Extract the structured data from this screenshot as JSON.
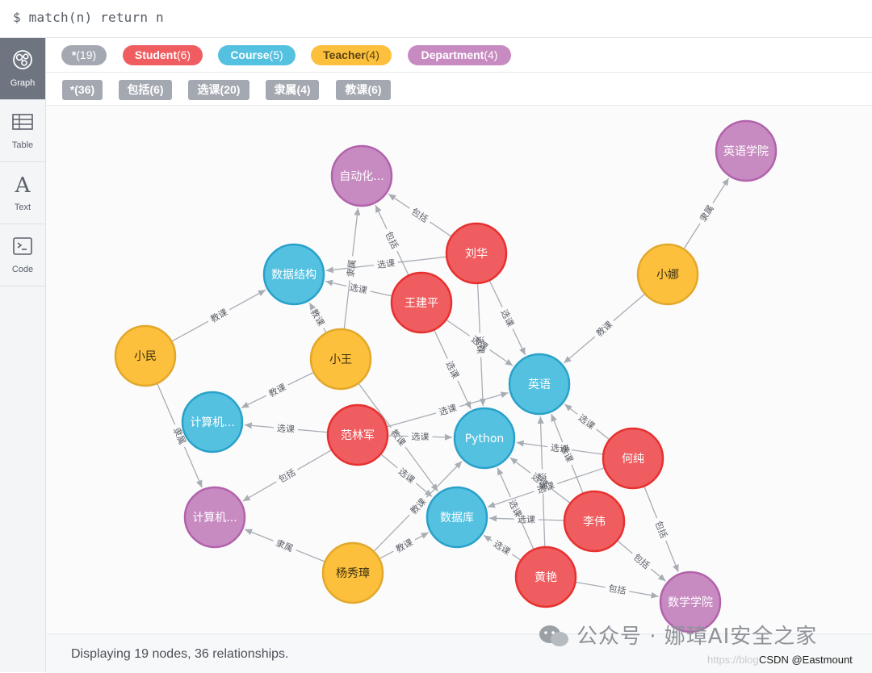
{
  "query": {
    "text": "$ match(n) return n"
  },
  "sidebar": {
    "items": [
      {
        "label": "Graph",
        "icon": "graph-icon",
        "active": true
      },
      {
        "label": "Table",
        "icon": "table-icon",
        "active": false
      },
      {
        "label": "Text",
        "icon": "text-icon",
        "active": false
      },
      {
        "label": "Code",
        "icon": "code-icon",
        "active": false
      }
    ]
  },
  "node_labels": [
    {
      "name": "*",
      "count": "(19)",
      "color": "#a4a8b1",
      "text_color": "#ffffff"
    },
    {
      "name": "Student",
      "count": "(6)",
      "color": "#ef5d60",
      "text_color": "#ffffff"
    },
    {
      "name": "Course",
      "count": "(5)",
      "color": "#54c1e0",
      "text_color": "#ffffff"
    },
    {
      "name": "Teacher",
      "count": "(4)",
      "color": "#fcc03c",
      "text_color": "#5a4410"
    },
    {
      "name": "Department",
      "count": "(4)",
      "color": "#c78bc2",
      "text_color": "#ffffff"
    }
  ],
  "relationship_types": [
    {
      "name": "*",
      "count": "(36)"
    },
    {
      "name": "包括",
      "count": "(6)"
    },
    {
      "name": "选课",
      "count": "(20)"
    },
    {
      "name": "隶属",
      "count": "(4)"
    },
    {
      "name": "教课",
      "count": "(6)"
    }
  ],
  "colors": {
    "Student": {
      "fill": "#ef5d60",
      "stroke": "#e6312f"
    },
    "Course": {
      "fill": "#54c1e0",
      "stroke": "#2aa1c9"
    },
    "Teacher": {
      "fill": "#fcc03c",
      "stroke": "#e2a82b"
    },
    "Department": {
      "fill": "#c78bc2",
      "stroke": "#b262ab"
    },
    "edge": "#a8adb4",
    "edge_label": "#5d6168"
  },
  "graph": {
    "nodes": [
      {
        "id": "zidonghua",
        "label": "Department",
        "caption": "自动化..."
      },
      {
        "id": "yingyu_xy",
        "label": "Department",
        "caption": "英语学院"
      },
      {
        "id": "jisuanji_xy",
        "label": "Department",
        "caption": "计算机..."
      },
      {
        "id": "shuxue_xy",
        "label": "Department",
        "caption": "数学学院"
      },
      {
        "id": "shujujiegou",
        "label": "Course",
        "caption": "数据结构"
      },
      {
        "id": "yingyu",
        "label": "Course",
        "caption": "英语"
      },
      {
        "id": "jisuanji_c",
        "label": "Course",
        "caption": "计算机..."
      },
      {
        "id": "python",
        "label": "Course",
        "caption": "Python"
      },
      {
        "id": "shujuku",
        "label": "Course",
        "caption": "数据库"
      },
      {
        "id": "liuhua",
        "label": "Student",
        "caption": "刘华"
      },
      {
        "id": "wangjianping",
        "label": "Student",
        "caption": "王建平"
      },
      {
        "id": "fanlinjun",
        "label": "Student",
        "caption": "范林军"
      },
      {
        "id": "hechun",
        "label": "Student",
        "caption": "何纯"
      },
      {
        "id": "liwei",
        "label": "Student",
        "caption": "李伟"
      },
      {
        "id": "huangyan",
        "label": "Student",
        "caption": "黄艳"
      },
      {
        "id": "xiaomin",
        "label": "Teacher",
        "caption": "小民"
      },
      {
        "id": "xiaowang",
        "label": "Teacher",
        "caption": "小王"
      },
      {
        "id": "xiaona",
        "label": "Teacher",
        "caption": "小娜"
      },
      {
        "id": "yangxiuzhang",
        "label": "Teacher",
        "caption": "杨秀璋"
      }
    ],
    "edges": [
      {
        "from": "liuhua",
        "to": "zidonghua",
        "type": "包括"
      },
      {
        "from": "wangjianping",
        "to": "zidonghua",
        "type": "包括"
      },
      {
        "from": "liuhua",
        "to": "shujujiegou",
        "type": "选课"
      },
      {
        "from": "wangjianping",
        "to": "shujujiegou",
        "type": "选课"
      },
      {
        "from": "liuhua",
        "to": "yingyu",
        "type": "选课"
      },
      {
        "from": "liuhua",
        "to": "python",
        "type": "选课"
      },
      {
        "from": "wangjianping",
        "to": "yingyu",
        "type": "选课"
      },
      {
        "from": "wangjianping",
        "to": "python",
        "type": "选课"
      },
      {
        "from": "xiaowang",
        "to": "zidonghua",
        "type": "隶属"
      },
      {
        "from": "xiaowang",
        "to": "shujujiegou",
        "type": "教课"
      },
      {
        "from": "xiaowang",
        "to": "jisuanji_c",
        "type": "教课"
      },
      {
        "from": "xiaowang",
        "to": "shujuku",
        "type": "教课"
      },
      {
        "from": "xiaomin",
        "to": "shujujiegou",
        "type": "教课"
      },
      {
        "from": "xiaomin",
        "to": "jisuanji_xy",
        "type": "隶属"
      },
      {
        "from": "xiaona",
        "to": "yingyu_xy",
        "type": "隶属"
      },
      {
        "from": "xiaona",
        "to": "yingyu",
        "type": "教课"
      },
      {
        "from": "fanlinjun",
        "to": "jisuanji_c",
        "type": "选课"
      },
      {
        "from": "fanlinjun",
        "to": "jisuanji_xy",
        "type": "包括"
      },
      {
        "from": "fanlinjun",
        "to": "yingyu",
        "type": "选课"
      },
      {
        "from": "fanlinjun",
        "to": "python",
        "type": "选课"
      },
      {
        "from": "fanlinjun",
        "to": "shujuku",
        "type": "选课"
      },
      {
        "from": "hechun",
        "to": "yingyu",
        "type": "选课"
      },
      {
        "from": "hechun",
        "to": "python",
        "type": "选课"
      },
      {
        "from": "hechun",
        "to": "shujuku",
        "type": "选课"
      },
      {
        "from": "hechun",
        "to": "shuxue_xy",
        "type": "包括"
      },
      {
        "from": "liwei",
        "to": "yingyu",
        "type": "选课"
      },
      {
        "from": "liwei",
        "to": "python",
        "type": "选课"
      },
      {
        "from": "liwei",
        "to": "shujuku",
        "type": "选课"
      },
      {
        "from": "liwei",
        "to": "shuxue_xy",
        "type": "包括"
      },
      {
        "from": "huangyan",
        "to": "yingyu",
        "type": "选课"
      },
      {
        "from": "huangyan",
        "to": "python",
        "type": "选课"
      },
      {
        "from": "huangyan",
        "to": "shujuku",
        "type": "选课"
      },
      {
        "from": "huangyan",
        "to": "shuxue_xy",
        "type": "包括"
      },
      {
        "from": "yangxiuzhang",
        "to": "jisuanji_xy",
        "type": "隶属"
      },
      {
        "from": "yangxiuzhang",
        "to": "shujuku",
        "type": "教课"
      },
      {
        "from": "yangxiuzhang",
        "to": "python",
        "type": "教课"
      }
    ]
  },
  "status": {
    "text": "Displaying 19 nodes, 36 relationships."
  },
  "watermark": {
    "text": "公众号 · 娜璋AI安全之家"
  },
  "credit": {
    "blog": "https://blog",
    "text": "CSDN @Eastmount"
  }
}
